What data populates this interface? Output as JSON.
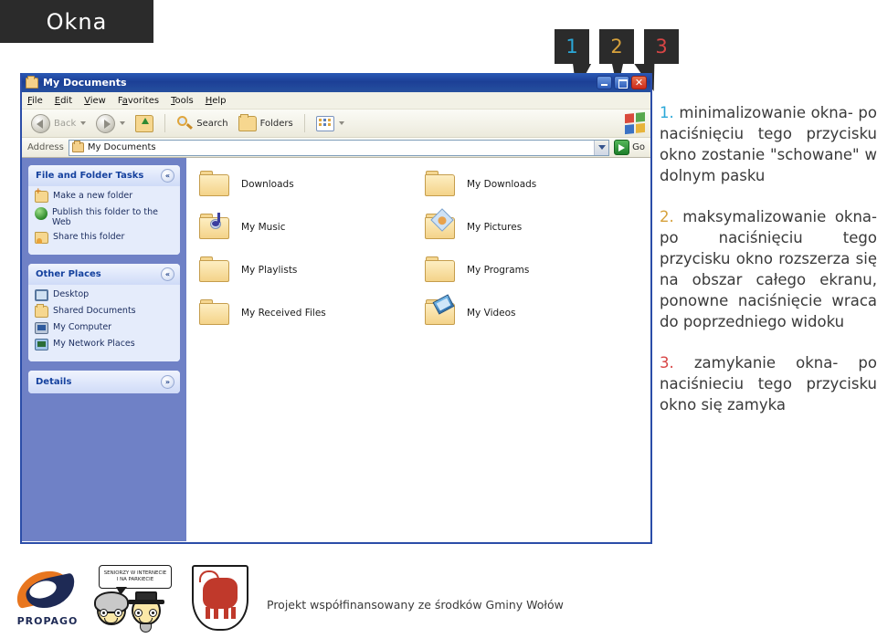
{
  "header": {
    "title": "Okna"
  },
  "callouts": [
    {
      "num": "1",
      "color": "#2ba8d8"
    },
    {
      "num": "2",
      "color": "#d6a13c"
    },
    {
      "num": "3",
      "color": "#d84545"
    }
  ],
  "window": {
    "title": "My Documents",
    "controls": {
      "minimize": "_",
      "maximize": "□",
      "close": "✕"
    },
    "menu": [
      "File",
      "Edit",
      "View",
      "Favorites",
      "Tools",
      "Help"
    ],
    "toolbar": {
      "back": "Back",
      "search": "Search",
      "folders": "Folders"
    },
    "address": {
      "label": "Address",
      "value": "My Documents",
      "go": "Go"
    },
    "sidebar": {
      "panels": [
        {
          "title": "File and Folder Tasks",
          "chevron": "«",
          "items": [
            {
              "label": "Make a new folder",
              "icon": "folder-new"
            },
            {
              "label": "Publish this folder to the Web",
              "icon": "globe"
            },
            {
              "label": "Share this folder",
              "icon": "share"
            }
          ]
        },
        {
          "title": "Other Places",
          "chevron": "«",
          "items": [
            {
              "label": "Desktop",
              "icon": "desktop"
            },
            {
              "label": "Shared Documents",
              "icon": "folder"
            },
            {
              "label": "My Computer",
              "icon": "computer"
            },
            {
              "label": "My Network Places",
              "icon": "network"
            }
          ]
        },
        {
          "title": "Details",
          "chevron": "»",
          "items": []
        }
      ]
    },
    "folders": [
      {
        "label": "Downloads",
        "type": "plain"
      },
      {
        "label": "My Downloads",
        "type": "plain"
      },
      {
        "label": "My Music",
        "type": "music"
      },
      {
        "label": "My Pictures",
        "type": "pictures"
      },
      {
        "label": "My Playlists",
        "type": "plain"
      },
      {
        "label": "My Programs",
        "type": "plain"
      },
      {
        "label": "My Received Files",
        "type": "plain"
      },
      {
        "label": "My Videos",
        "type": "videos"
      }
    ]
  },
  "notes": [
    {
      "num": "1.",
      "text": " minimalizowanie okna- po naciśnięciu tego przycisku okno zostanie \"schowane\" w dolnym pasku"
    },
    {
      "num": "2.",
      "text": " maksymalizowanie okna- po naciśnięciu tego przycisku okno rozszerza się na obszar całego ekranu, ponowne naciśnięcie wraca do poprzedniego widoku"
    },
    {
      "num": "3.",
      "text": " zamykanie okna- po naciśnieciu tego przycisku okno się zamyka"
    }
  ],
  "footer": {
    "propago_label": "PROPAGO",
    "seniorzy_line1": "SENIORZY W INTERNECIE",
    "seniorzy_line2": "I NA PARKIECIE",
    "project_text": "Projekt współfinansowany ze środków Gminy Wołów"
  }
}
